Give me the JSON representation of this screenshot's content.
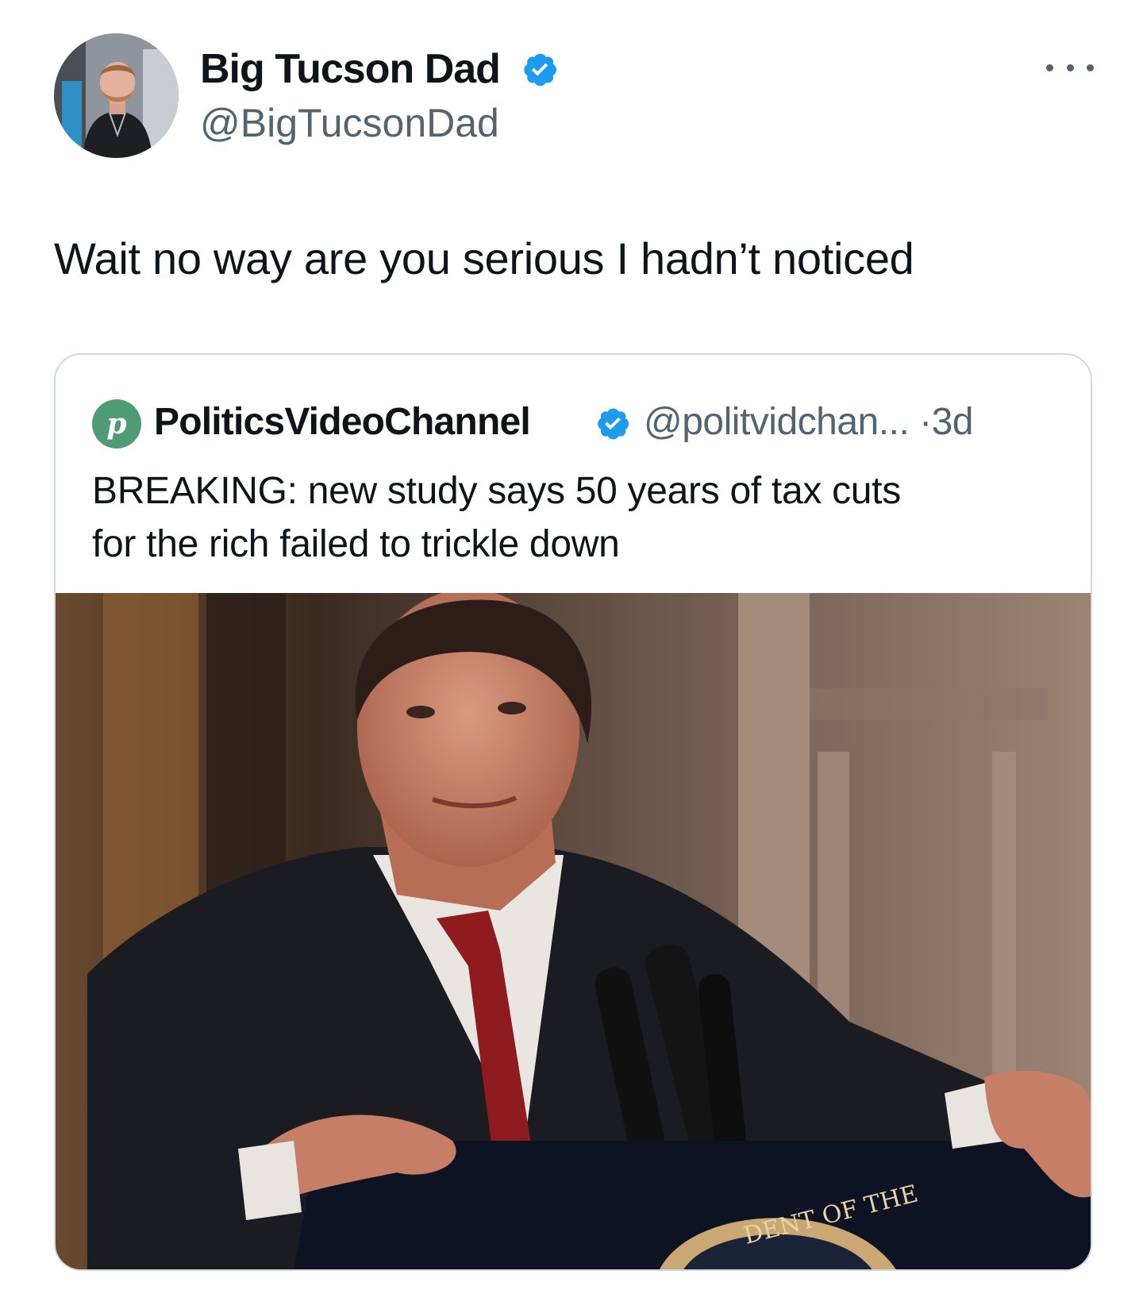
{
  "author": {
    "name": "Big Tucson Dad",
    "handle": "@BigTucsonDad",
    "verified_icon": "verified-badge-icon",
    "avatar_icon": "user-avatar"
  },
  "more_icon": "more-horizontal-icon",
  "tweet": {
    "text": "Wait no way are you serious I hadn’t noticed"
  },
  "quoted": {
    "name": "PoliticsVideoChannel",
    "avatar_letter": "P",
    "handle": "@politvidchan...",
    "separator": "·",
    "time": "3d",
    "text_lines": [
      "BREAKING: new study says 50 years of tax cuts",
      "for the rich failed to trickle down"
    ],
    "image_seal_text": "DENT OF THE"
  },
  "colors": {
    "verified": "#1d9bf0",
    "secondary_text": "#536471",
    "border": "#cfd9de",
    "channel_avatar": "#4f9b74"
  }
}
